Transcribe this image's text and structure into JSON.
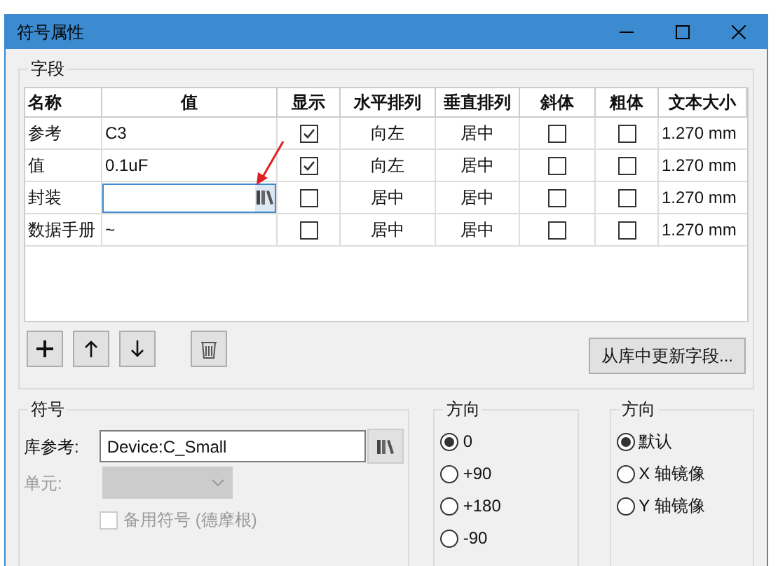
{
  "window": {
    "title": "符号属性"
  },
  "fields": {
    "title": "字段",
    "columns": [
      "名称",
      "值",
      "显示",
      "水平排列",
      "垂直排列",
      "斜体",
      "粗体",
      "文本大小"
    ],
    "rows": [
      {
        "name": "参考",
        "value": "C3",
        "editing": false,
        "show": true,
        "h_align": "向左",
        "v_align": "居中",
        "italic": false,
        "bold": false,
        "text_size": "1.270 mm"
      },
      {
        "name": "值",
        "value": "0.1uF",
        "editing": false,
        "show": true,
        "h_align": "向左",
        "v_align": "居中",
        "italic": false,
        "bold": false,
        "text_size": "1.270 mm"
      },
      {
        "name": "封装",
        "editing": true,
        "show": false,
        "h_align": "居中",
        "v_align": "居中",
        "italic": false,
        "bold": false,
        "text_size": "1.270 mm"
      },
      {
        "name": "数据手册",
        "value": "~",
        "editing": false,
        "show": false,
        "h_align": "居中",
        "v_align": "居中",
        "italic": false,
        "bold": false,
        "text_size": "1.270 mm"
      }
    ],
    "update_button": "从库中更新字段..."
  },
  "symbol": {
    "title": "符号",
    "lib_ref_label": "库参考:",
    "lib_ref": "Device:C_Small",
    "unit_label": "单元:",
    "unit_disabled": true,
    "alternate": {
      "label": "备用符号 (德摩根)",
      "checked": false,
      "disabled": true
    }
  },
  "orientation": {
    "title": "方向",
    "options": [
      {
        "label": "0",
        "selected": true
      },
      {
        "label": "+90",
        "selected": false
      },
      {
        "label": "+180",
        "selected": false
      },
      {
        "label": "-90",
        "selected": false
      }
    ]
  },
  "mirror": {
    "title": "方向",
    "options": [
      {
        "label": "默认",
        "selected": true
      },
      {
        "label": "X 轴镜像",
        "selected": false
      },
      {
        "label": "Y 轴镜像",
        "selected": false
      }
    ]
  }
}
